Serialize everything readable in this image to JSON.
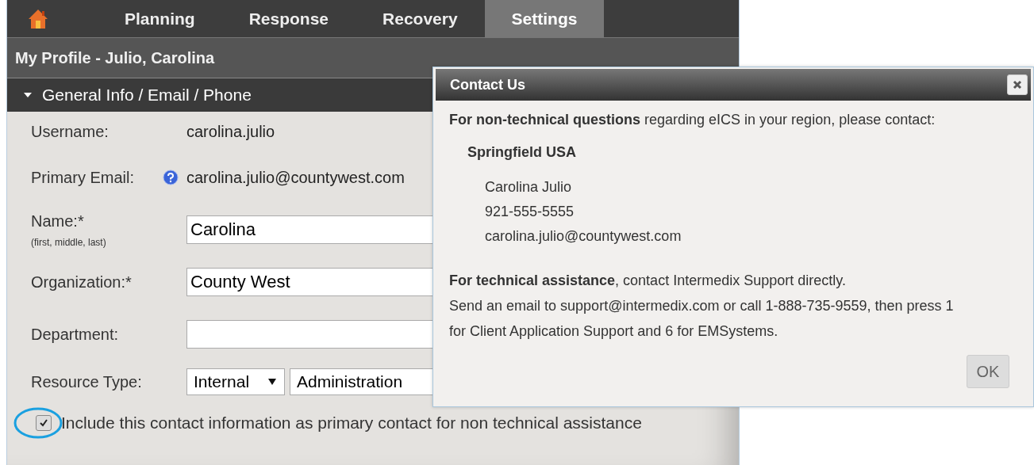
{
  "nav": {
    "tabs": [
      {
        "label": "Planning",
        "selected": false
      },
      {
        "label": "Response",
        "selected": false
      },
      {
        "label": "Recovery",
        "selected": false
      },
      {
        "label": "Settings",
        "selected": true
      }
    ]
  },
  "profile_title": "My Profile - Julio, Carolina",
  "section": {
    "title": "General Info / Email / Phone",
    "expanded": true
  },
  "fields": [
    {
      "kind": "text",
      "label": "Username:",
      "value": "carolina.julio"
    },
    {
      "kind": "email",
      "label": "Primary Email:",
      "value": "carolina.julio@countywest.com"
    },
    {
      "kind": "input",
      "label": "Name:*",
      "hint": "(first, middle, last)",
      "value": "Carolina"
    },
    {
      "kind": "input",
      "label": "Organization:*",
      "value": "County West"
    },
    {
      "kind": "input",
      "label": "Department:"
    },
    {
      "kind": "selects",
      "label": "Resource Type:",
      "values": [
        "Internal",
        "Administration"
      ]
    }
  ],
  "checkbox": {
    "label": "Include this contact information as primary contact for non technical assistance",
    "checked": true
  },
  "dialog": {
    "title": "Contact Us",
    "intro": "**For non-technical questions** regarding eICS in your region, please contact:",
    "region": "Springfield USA",
    "contact_lines": [
      "Carolina Julio",
      "921-555-5555",
      "carolina.julio@countywest.com"
    ],
    "tech_lines": [
      "**For technical assistance**, contact Intermedix Support directly.",
      "Send an email to support@intermedix.com or call 1-888-735-9559, then press 1",
      "for Client Application Support and 6 for EMSystems."
    ],
    "button": "OK"
  }
}
